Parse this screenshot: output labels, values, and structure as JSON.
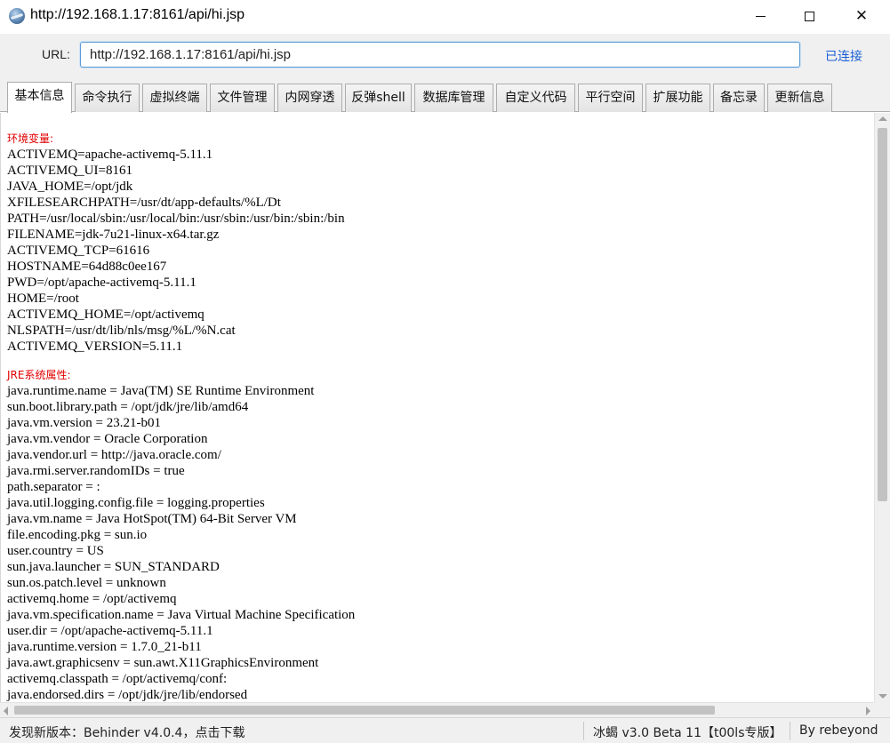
{
  "window": {
    "title": "http://192.168.1.17:8161/api/hi.jsp",
    "minimize_glyph": "",
    "maximize_glyph": "",
    "close_glyph": "✕"
  },
  "urlbar": {
    "label": "URL:",
    "value": "http://192.168.1.17:8161/api/hi.jsp",
    "status": "已连接"
  },
  "tabs": [
    {
      "label": "基本信息",
      "active": true
    },
    {
      "label": "命令执行"
    },
    {
      "label": "虚拟终端"
    },
    {
      "label": "文件管理"
    },
    {
      "label": "内网穿透"
    },
    {
      "label": "反弹shell"
    },
    {
      "label": "数据库管理"
    },
    {
      "label": "自定义代码"
    },
    {
      "label": "平行空间"
    },
    {
      "label": "扩展功能"
    },
    {
      "label": "备忘录"
    },
    {
      "label": "更新信息"
    }
  ],
  "content": {
    "env_title": "环境变量:",
    "env_lines": [
      "ACTIVEMQ=apache-activemq-5.11.1",
      "ACTIVEMQ_UI=8161",
      "JAVA_HOME=/opt/jdk",
      "XFILESEARCHPATH=/usr/dt/app-defaults/%L/Dt",
      "PATH=/usr/local/sbin:/usr/local/bin:/usr/sbin:/usr/bin:/sbin:/bin",
      "FILENAME=jdk-7u21-linux-x64.tar.gz",
      "ACTIVEMQ_TCP=61616",
      "HOSTNAME=64d88c0ee167",
      "PWD=/opt/apache-activemq-5.11.1",
      "HOME=/root",
      "ACTIVEMQ_HOME=/opt/activemq",
      "NLSPATH=/usr/dt/lib/nls/msg/%L/%N.cat",
      "ACTIVEMQ_VERSION=5.11.1"
    ],
    "jre_title": "JRE系统属性:",
    "jre_lines": [
      "java.runtime.name = Java(TM) SE Runtime Environment",
      "sun.boot.library.path = /opt/jdk/jre/lib/amd64",
      "java.vm.version = 23.21-b01",
      "java.vm.vendor = Oracle Corporation",
      "java.vendor.url = http://java.oracle.com/",
      "java.rmi.server.randomIDs = true",
      "path.separator = :",
      "java.util.logging.config.file = logging.properties",
      "java.vm.name = Java HotSpot(TM) 64-Bit Server VM",
      "file.encoding.pkg = sun.io",
      "user.country = US",
      "sun.java.launcher = SUN_STANDARD",
      "sun.os.patch.level = unknown",
      "activemq.home = /opt/activemq",
      "java.vm.specification.name = Java Virtual Machine Specification",
      "user.dir = /opt/apache-activemq-5.11.1",
      "java.runtime.version = 1.7.0_21-b11",
      "java.awt.graphicsenv = sun.awt.X11GraphicsEnvironment",
      "activemq.classpath = /opt/activemq/conf:",
      "java.endorsed.dirs = /opt/jdk/jre/lib/endorsed"
    ]
  },
  "statusbar": {
    "update_notice": "发现新版本：Behinder v4.0.4，点击下载",
    "version": "冰蝎 v3.0 Beta 11【t00ls专版】",
    "author": "By rebeyond"
  },
  "colors": {
    "section_title": "#e00000",
    "connected_status": "#1a5fd6",
    "url_border": "#5b9bd5",
    "chrome_bg": "#f0f0f0"
  }
}
